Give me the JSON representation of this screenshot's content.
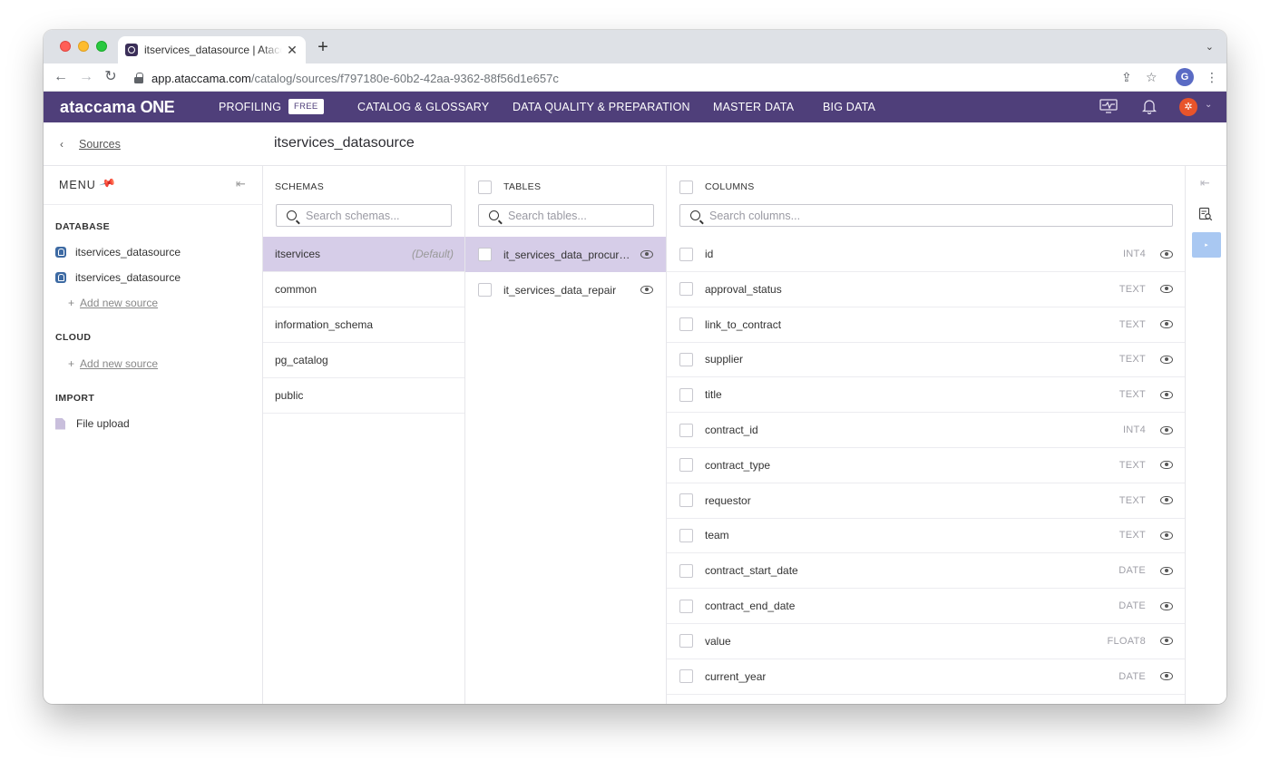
{
  "browser": {
    "tab_title": "itservices_datasource | Ataccama ONE",
    "url_host": "app.ataccama.com",
    "url_path": "/catalog/sources/f797180e-60b2-42aa-9362-88f56d1e657c",
    "profile_initial": "G",
    "new_tab": "+",
    "close_tab": "✕"
  },
  "appbar": {
    "logo_text": "ataccama",
    "logo_suffix": "ONE",
    "nav": [
      "PROFILING",
      "CATALOG & GLOSSARY",
      "DATA QUALITY & PREPARATION",
      "MASTER DATA",
      "BIG DATA"
    ],
    "free_badge": "FREE"
  },
  "breadcrumb": {
    "back_label": "Sources",
    "page_title": "itservices_datasource"
  },
  "menu": {
    "title": "MENU",
    "database_header": "DATABASE",
    "database_items": [
      "itservices_datasource",
      "itservices_datasource"
    ],
    "add_new_source": "Add new source",
    "cloud_header": "CLOUD",
    "import_header": "IMPORT",
    "file_upload": "File upload"
  },
  "schemas": {
    "header": "SCHEMAS",
    "placeholder": "Search schemas...",
    "items": [
      "itservices",
      "common",
      "information_schema",
      "pg_catalog",
      "public"
    ],
    "default_tag": "(Default)"
  },
  "tables": {
    "header": "TABLES",
    "placeholder": "Search tables...",
    "items": [
      "it_services_data_procurement",
      "it_services_data_repair"
    ]
  },
  "columns": {
    "header": "COLUMNS",
    "placeholder": "Search columns...",
    "items": [
      {
        "name": "id",
        "type": "INT4"
      },
      {
        "name": "approval_status",
        "type": "TEXT"
      },
      {
        "name": "link_to_contract",
        "type": "TEXT"
      },
      {
        "name": "supplier",
        "type": "TEXT"
      },
      {
        "name": "title",
        "type": "TEXT"
      },
      {
        "name": "contract_id",
        "type": "INT4"
      },
      {
        "name": "contract_type",
        "type": "TEXT"
      },
      {
        "name": "requestor",
        "type": "TEXT"
      },
      {
        "name": "team",
        "type": "TEXT"
      },
      {
        "name": "contract_start_date",
        "type": "DATE"
      },
      {
        "name": "contract_end_date",
        "type": "DATE"
      },
      {
        "name": "value",
        "type": "FLOAT8"
      },
      {
        "name": "current_year",
        "type": "DATE"
      }
    ]
  },
  "colors": {
    "appbar": "#4f3f7a",
    "selected_row": "#d6cde8",
    "rail_tab": "#a9c8f2"
  }
}
